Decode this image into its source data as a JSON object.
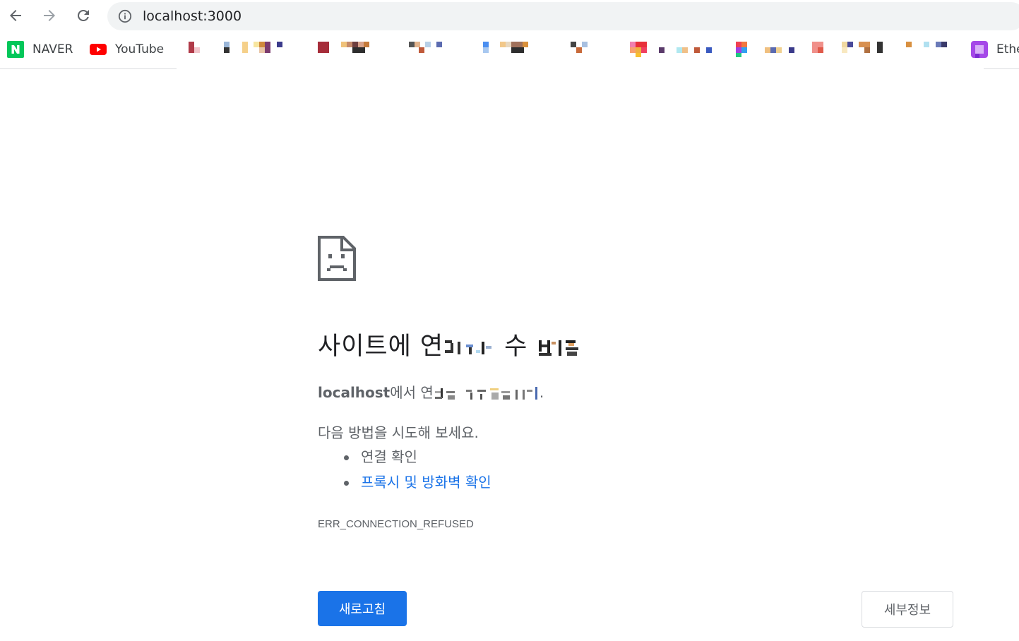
{
  "browser": {
    "address_bar": {
      "url": "localhost:3000"
    },
    "bookmarks": [
      {
        "label": "NAVER",
        "icon": "naver-icon"
      },
      {
        "label": "YouTube",
        "icon": "youtube-icon"
      },
      {
        "label": "Ethe",
        "icon": "purple-app-icon"
      }
    ]
  },
  "error_page": {
    "headline_visible": "사이트에 연",
    "headline_tail": "수",
    "subline_host": "localhost",
    "subline_text": "에서 연",
    "subline_end": ".",
    "suggest_title": "다음 방법을 시도해 보세요.",
    "suggestions": [
      {
        "label": "연결 확인"
      },
      {
        "label": "프록시 및 방화벽 확인"
      }
    ],
    "error_code": "ERR_CONNECTION_REFUSED",
    "reload_label": "새로고침",
    "details_label": "세부정보"
  },
  "colors": {
    "accent": "#1a73e8",
    "text_secondary": "#5f6368",
    "omnibox_bg": "#f1f3f4"
  }
}
